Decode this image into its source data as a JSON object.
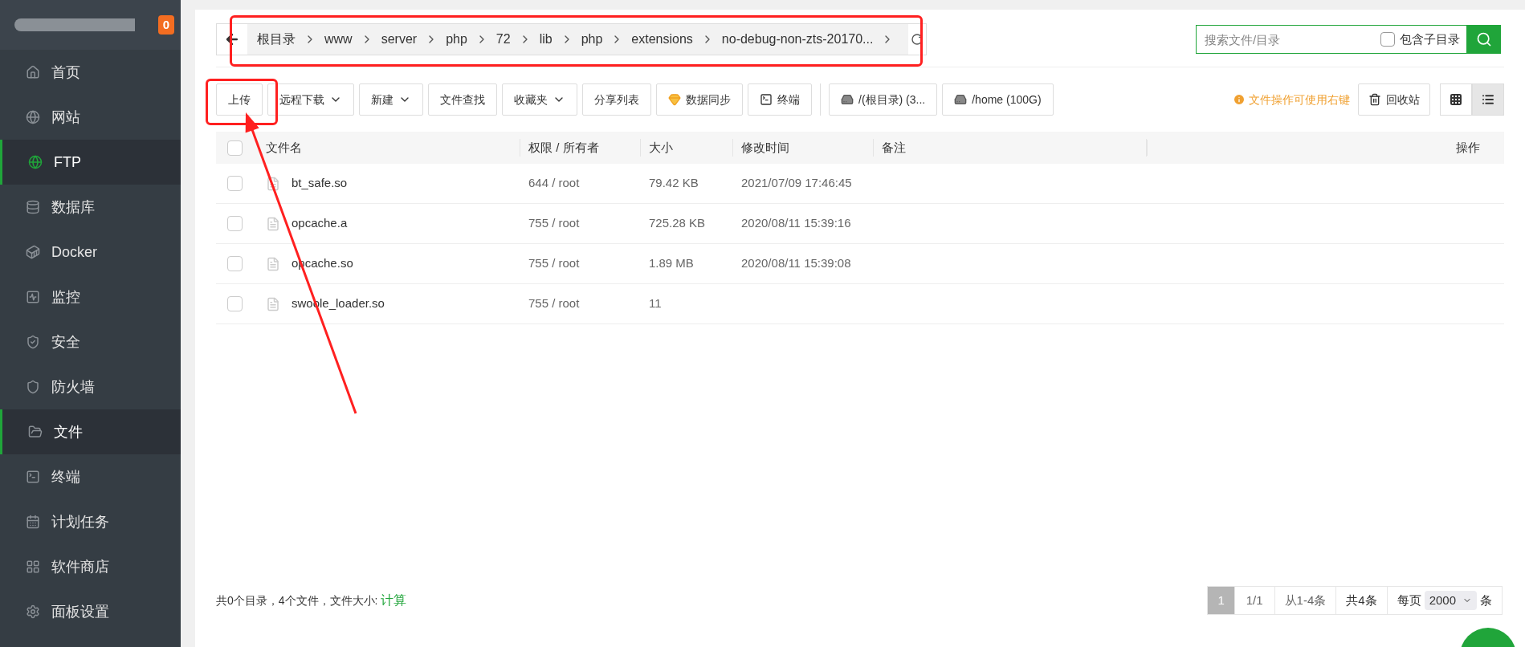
{
  "sidebar": {
    "badge": "0",
    "items": [
      {
        "label": "首页",
        "selected": false
      },
      {
        "label": "网站",
        "selected": false
      },
      {
        "label": "FTP",
        "selected": true
      },
      {
        "label": "数据库",
        "selected": false
      },
      {
        "label": "Docker",
        "selected": false
      },
      {
        "label": "监控",
        "selected": false
      },
      {
        "label": "安全",
        "selected": false
      },
      {
        "label": "防火墙",
        "selected": false
      },
      {
        "label": "文件",
        "selected": true
      },
      {
        "label": "终端",
        "selected": false
      },
      {
        "label": "计划任务",
        "selected": false
      },
      {
        "label": "软件商店",
        "selected": false
      },
      {
        "label": "面板设置",
        "selected": false
      }
    ]
  },
  "breadcrumb": [
    "根目录",
    "www",
    "server",
    "php",
    "72",
    "lib",
    "php",
    "extensions",
    "no-debug-non-zts-20170..."
  ],
  "search": {
    "placeholder": "搜索文件/目录",
    "include_subdirs": {
      "label": "包含子目录",
      "checked": false
    }
  },
  "toolbar": [
    {
      "label": "上传",
      "kind": "plain"
    },
    {
      "label": "远程下载",
      "kind": "dropdown"
    },
    {
      "label": "新建",
      "kind": "dropdown"
    },
    {
      "label": "文件查找",
      "kind": "plain"
    },
    {
      "label": "收藏夹",
      "kind": "dropdown"
    },
    {
      "label": "分享列表",
      "kind": "plain"
    },
    {
      "label": "数据同步",
      "kind": "gem"
    },
    {
      "label": "终端",
      "kind": "terminal"
    },
    {
      "label": "/(根目录) (3...",
      "kind": "disk"
    },
    {
      "label": "/home (100G)",
      "kind": "disk"
    }
  ],
  "hint": "文件操作可使用右键",
  "recycle": "回收站",
  "view_modes": [
    {
      "kind": "grid",
      "selected": false
    },
    {
      "kind": "list",
      "selected": true
    }
  ],
  "table": {
    "select_all_checked": false,
    "columns": [
      "文件名",
      "权限 / 所有者",
      "大小",
      "修改时间",
      "备注",
      "操作"
    ],
    "rows": [
      {
        "name": "bt_safe.so",
        "perm": "644 / root",
        "size": "79.42 KB",
        "mtime": "2021/07/09 17:46:45",
        "checked": false
      },
      {
        "name": "opcache.a",
        "perm": "755 / root",
        "size": "725.28 KB",
        "mtime": "2020/08/11 15:39:16",
        "checked": false
      },
      {
        "name": "opcache.so",
        "perm": "755 / root",
        "size": "1.89 MB",
        "mtime": "2020/08/11 15:39:08",
        "checked": false
      },
      {
        "name": "swoole_loader.so",
        "perm": "755 / root",
        "size": "11",
        "checked": false
      }
    ]
  },
  "footer": {
    "summary": "共0个目录，4个文件，文件大小:",
    "calc_link": "计算"
  },
  "pagination": {
    "pages": [
      {
        "label": "1",
        "selected": true
      }
    ],
    "page_of": "1/1",
    "range": "从1-4条",
    "total": "共4条",
    "per_page_label": "每页",
    "per_page": "2000",
    "unit": "条"
  }
}
